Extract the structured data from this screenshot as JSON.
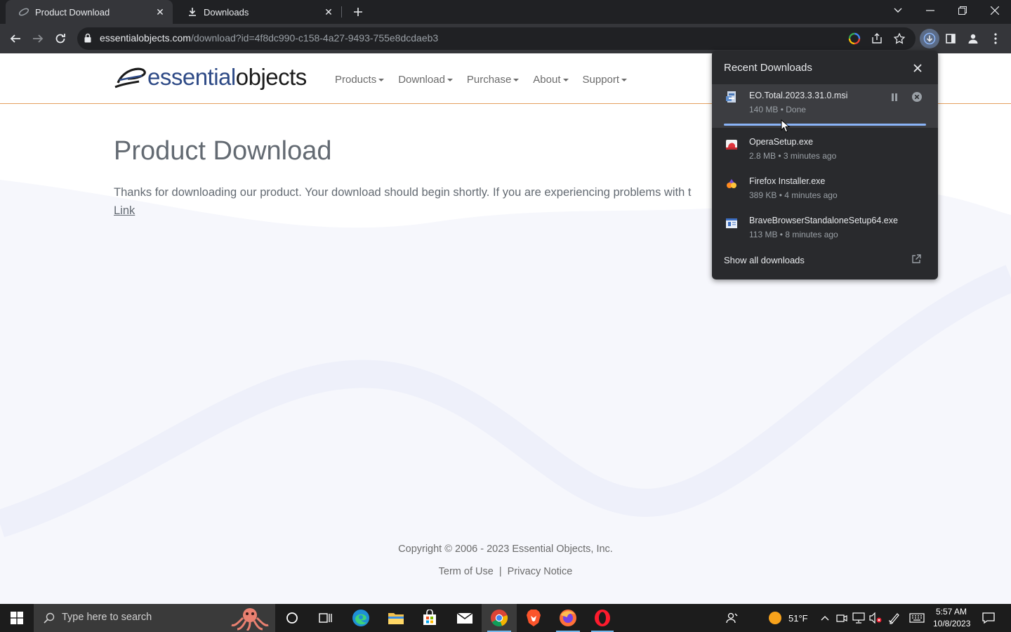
{
  "browser": {
    "tabs": [
      {
        "title": "Product Download",
        "active": true,
        "icon": "eo-favicon"
      },
      {
        "title": "Downloads",
        "active": false,
        "icon": "download-icon"
      }
    ],
    "url_host": "essentialobjects.com",
    "url_path": "/download?id=4f8dc990-c158-4a27-9493-755e8dcdaeb3"
  },
  "site": {
    "logo_part1": "essential",
    "logo_part2": "objects",
    "nav": [
      "Products",
      "Download",
      "Purchase",
      "About",
      "Support"
    ],
    "title": "Product Download",
    "message": "Thanks for downloading our product. Your download should begin shortly. If you are experiencing problems with t",
    "link": "Link",
    "copyright": "Copyright © 2006 - 2023 Essential Objects, Inc.",
    "footer_links": [
      "Term of Use",
      "Privacy Notice"
    ],
    "footer_sep": "|"
  },
  "downloads_panel": {
    "title": "Recent Downloads",
    "items": [
      {
        "name": "EO.Total.2023.3.31.0.msi",
        "status": "140 MB • Done",
        "icon": "msi-installer-icon",
        "progress": 1.0
      },
      {
        "name": "OperaSetup.exe",
        "status": "2.8 MB • 3 minutes ago",
        "icon": "opera-installer-icon"
      },
      {
        "name": "Firefox Installer.exe",
        "status": "389 KB • 4 minutes ago",
        "icon": "firefox-installer-icon"
      },
      {
        "name": "BraveBrowserStandaloneSetup64.exe",
        "status": "113 MB • 8 minutes ago",
        "icon": "brave-installer-icon"
      }
    ],
    "footer": "Show all downloads"
  },
  "taskbar": {
    "search_placeholder": "Type here to search",
    "weather": "51°F",
    "time": "5:57 AM",
    "date": "10/8/2023"
  },
  "colors": {
    "browser_frame": "#202124",
    "toolbar": "#35363a",
    "panel": "#292a2d",
    "accent_blue": "#8ab4f8",
    "header_rule": "#e4a060",
    "taskbar": "#1c1c1c"
  }
}
